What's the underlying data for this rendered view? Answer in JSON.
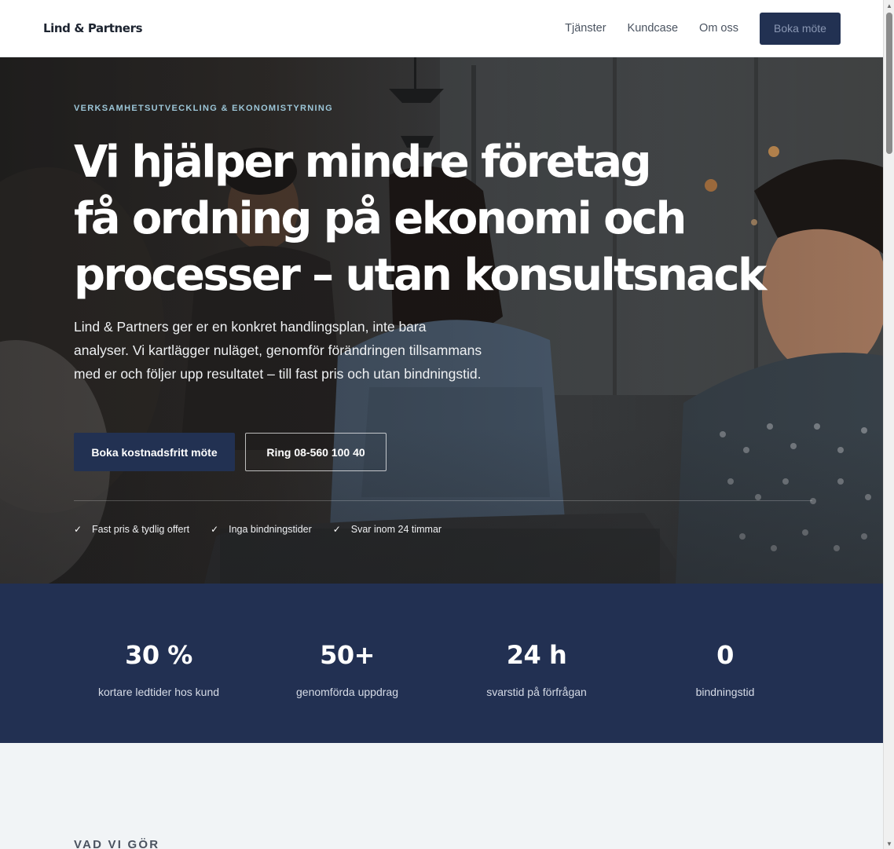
{
  "header": {
    "logo": "Lind & Partners",
    "nav": [
      "Tjänster",
      "Kundcase",
      "Om oss"
    ],
    "cta": "Boka möte"
  },
  "hero": {
    "eyebrow": "VERKSAMHETSUTVECKLING & EKONOMISTYRNING",
    "headline_lines": [
      "Vi hjälper mindre företag",
      "få ordning på ekonomi och",
      "processer – utan konsultsnack"
    ],
    "lead": "Lind & Partners ger er en konkret handlingsplan, inte bara analyser. Vi kartlägger nuläget, genomför förändringen tillsammans med er och följer upp resultatet – till fast pris och utan bindningstid.",
    "primary_button": "Boka kostnadsfritt möte",
    "secondary_button": "Ring 08-560 100 40",
    "benefits": [
      "Fast pris & tydlig offert",
      "Inga bindningstider",
      "Svar inom 24 timmar"
    ],
    "check_icon": "✓"
  },
  "stats": [
    {
      "value": "30 %",
      "label": "kortare ledtider hos kund"
    },
    {
      "value": "50+",
      "label": "genomförda uppdrag"
    },
    {
      "value": "24 h",
      "label": "svarstid på förfrågan"
    },
    {
      "value": "0",
      "label": "bindningstid"
    }
  ],
  "services": {
    "eyebrow": "VAD VI GÖR"
  },
  "colors": {
    "navy": "#223152",
    "stats_bg": "#223052",
    "eyebrow_accent": "#9cc6d8",
    "section_bg": "#f1f4f6"
  }
}
